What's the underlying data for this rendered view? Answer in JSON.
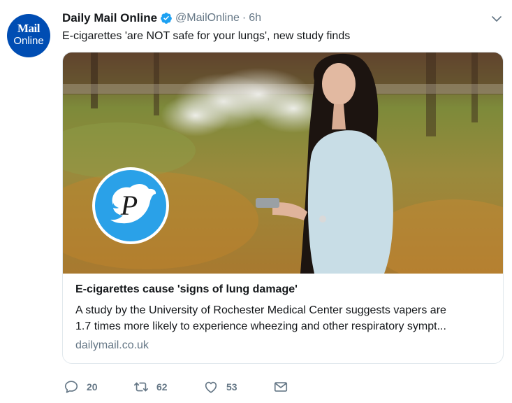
{
  "account": {
    "avatar_line1": "Mail",
    "avatar_line2": "Online",
    "name": "Daily Mail Online",
    "handle": "@MailOnline",
    "separator": "·",
    "time": "6h"
  },
  "tweet": {
    "text": "E-cigarettes 'are NOT safe for your lungs', new study finds"
  },
  "card": {
    "title": "E-cigarettes cause 'signs of lung damage'",
    "description_line1": "A study by the University of Rochester Medical Center suggests vapers are",
    "description_line2": "1.7 times more likely to experience wheezing and other respiratory sympt...",
    "domain": "dailymail.co.uk",
    "watermark_letter": "P"
  },
  "actions": {
    "replies": "20",
    "retweets": "62",
    "likes": "53"
  },
  "colors": {
    "verified": "#1da1f2",
    "avatar_bg": "#004db3",
    "secondary_text": "#657786",
    "border": "#e1e8ed",
    "watermark_bg": "#2aa1e8"
  },
  "icons": [
    "verified-badge-icon",
    "chevron-down-icon",
    "reply-icon",
    "retweet-icon",
    "heart-icon",
    "envelope-icon",
    "twitter-bird-icon"
  ]
}
